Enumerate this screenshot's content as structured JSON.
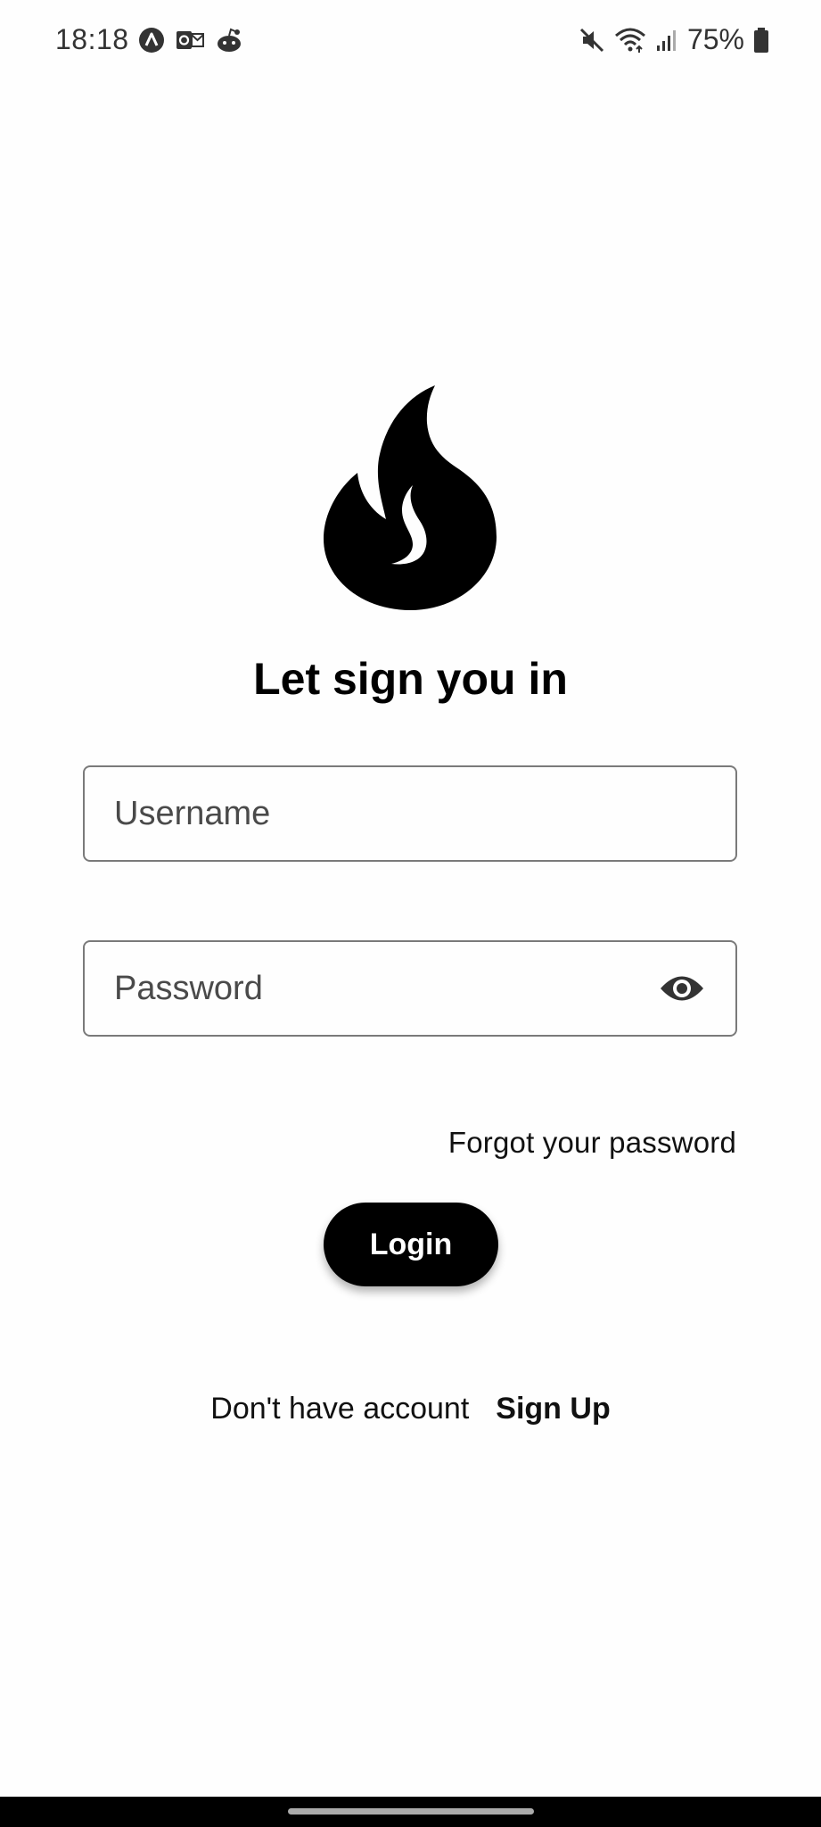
{
  "status_bar": {
    "time": "18:18",
    "battery": "75%"
  },
  "login": {
    "title": "Let sign you in",
    "username_placeholder": "Username",
    "password_placeholder": "Password",
    "forgot_label": "Forgot your password",
    "login_label": "Login",
    "no_account_text": "Don't have account",
    "signup_label": "Sign Up"
  }
}
